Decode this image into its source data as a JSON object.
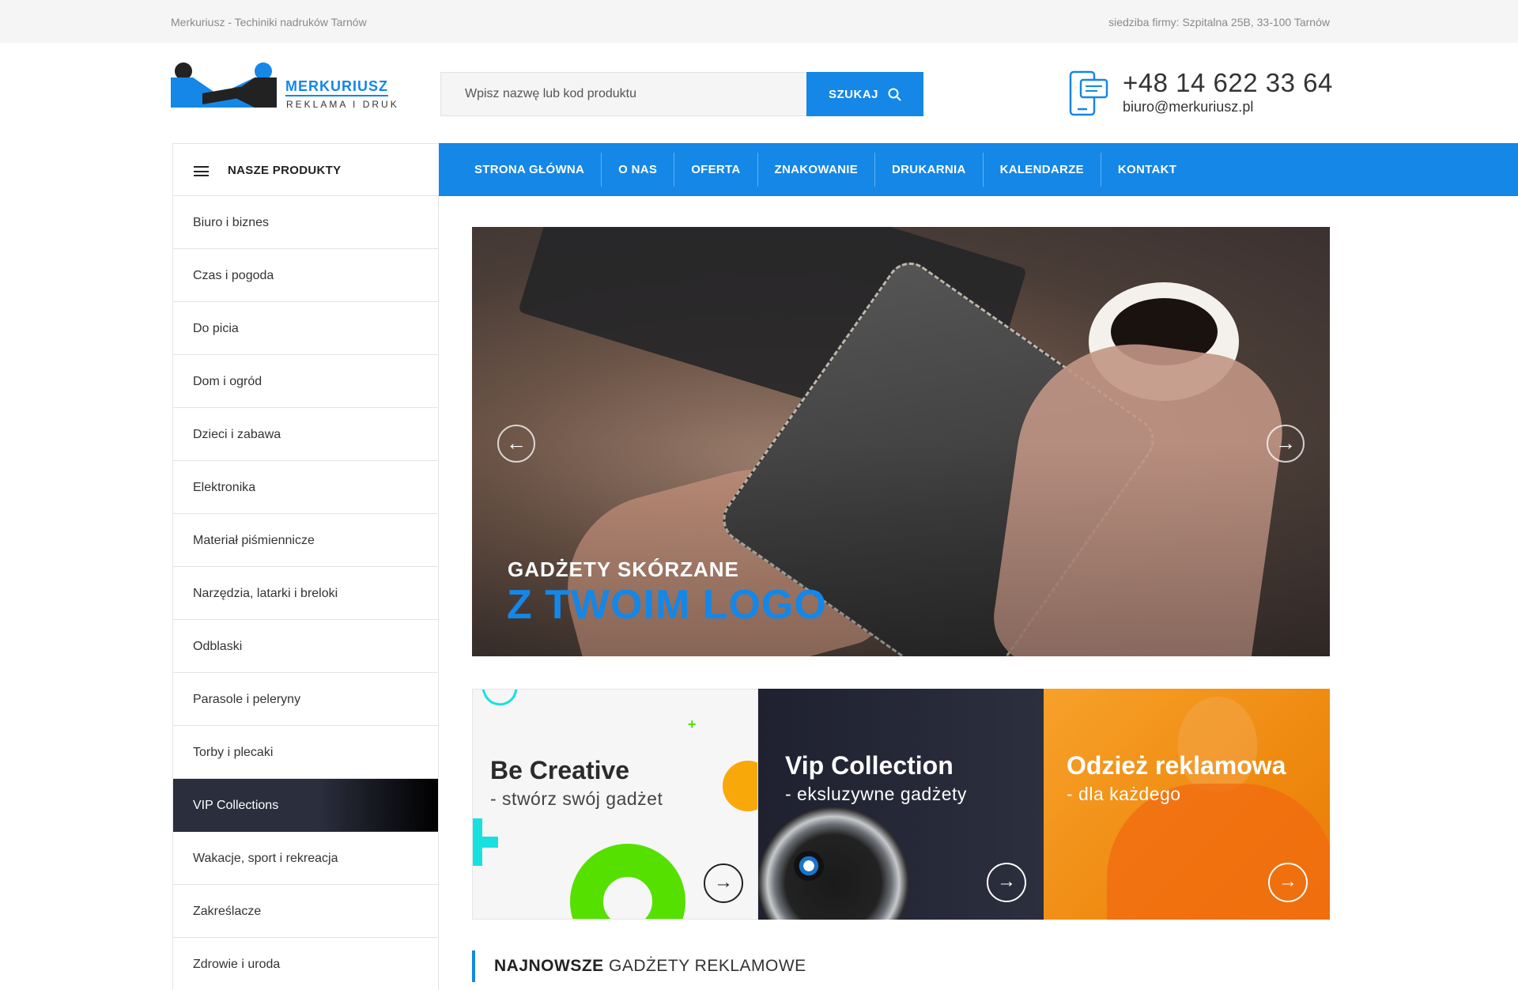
{
  "topbar": {
    "left_text": "Merkuriusz - Techiniki nadruków Tarnów",
    "right_label": "siedziba firmy:",
    "right_address": "Szpitalna 25B, 33-100 Tarnów"
  },
  "logo": {
    "brand": "MERKURIUSZ",
    "tagline": "REKLAMA I DRUK"
  },
  "search": {
    "placeholder": "Wpisz nazwę lub kod produktu",
    "button_label": "SZUKAJ"
  },
  "contact": {
    "phone": "+48 14 622 33 64",
    "email": "biuro@merkuriusz.pl"
  },
  "products_menu": {
    "label": "NASZE PRODUKTY",
    "items": [
      "Biuro i biznes",
      "Czas i pogoda",
      "Do picia",
      "Dom i ogród",
      "Dzieci i zabawa",
      "Elektronika",
      "Materiał piśmiennicze",
      "Narzędzia, latarki i breloki",
      "Odblaski",
      "Parasole i peleryny",
      "Torby i plecaki",
      "VIP Collections",
      "Wakacje, sport i rekreacja",
      "Zakreślacze",
      "Zdrowie i uroda"
    ],
    "active_item": "VIP Collections"
  },
  "nav": {
    "items": [
      "STRONA GŁÓWNA",
      "O NAS",
      "OFERTA",
      "ZNAKOWANIE",
      "DRUKARNIA",
      "KALENDARZE",
      "KONTAKT"
    ]
  },
  "hero": {
    "subtitle": "GADŻETY SKÓRZANE",
    "title": "Z TWOIM LOGO",
    "prev_icon": "arrow-left-icon",
    "next_icon": "arrow-right-icon"
  },
  "tiles": [
    {
      "title": "Be Creative",
      "subtitle": "- stwórz swój gadżet"
    },
    {
      "title": "Vip Collection",
      "subtitle": "- eksluzywne gadżety"
    },
    {
      "title": "Odzież reklamowa",
      "subtitle": "- dla każdego"
    }
  ],
  "section": {
    "title_bold": "NAJNOWSZE",
    "title_rest": "GADŻETY REKLAMOWE"
  },
  "colors": {
    "accent": "#1487e7",
    "dark": "#2b2e3d",
    "orange": "#f39418"
  }
}
